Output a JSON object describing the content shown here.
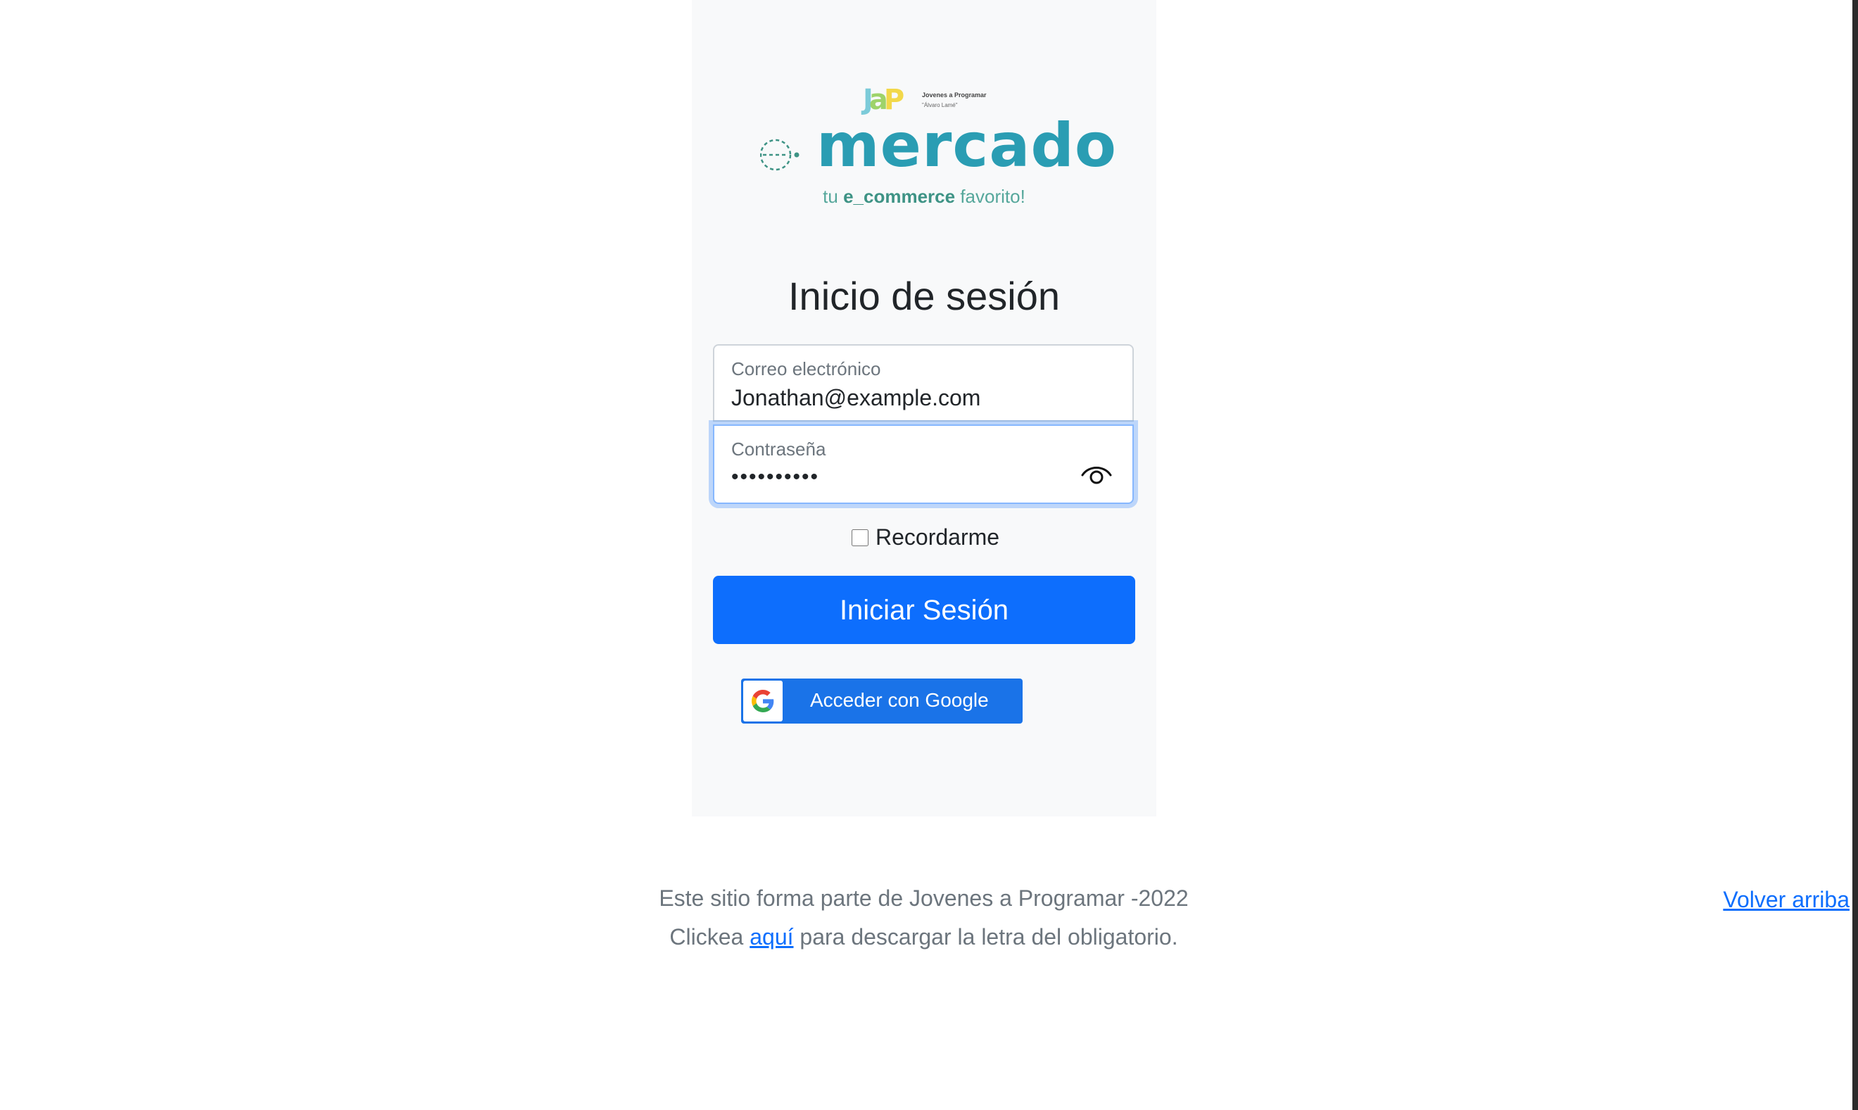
{
  "brand": {
    "jap_sub_line1": "Jovenes a Programar",
    "jap_sub_line2": "\"Álvaro Lamé\"",
    "logo_word": "mercado",
    "tagline_prefix": "tu ",
    "tagline_bold": "e_commerce",
    "tagline_suffix": " favorito!",
    "accent_color": "#2a9db3",
    "tagline_color": "#55a79b"
  },
  "login": {
    "heading": "Inicio de sesión",
    "email_label": "Correo electrónico",
    "email_value": "Jonathan@example.com",
    "password_label": "Contraseña",
    "password_value": "••••••••••",
    "show_password_icon": "eye-icon",
    "remember_label": "Recordarme",
    "remember_checked": false,
    "submit_label": "Iniciar Sesión",
    "submit_color": "#0d6efd",
    "google_label": "Acceder con Google",
    "google_color": "#1a73e8"
  },
  "footer": {
    "line1": "Este sitio forma parte de Jovenes a Programar -2022",
    "line2_prefix": "Clickea ",
    "line2_link": "aquí",
    "line2_suffix": " para descargar la letra del obligatorio.",
    "back_to_top": "Volver arriba"
  }
}
